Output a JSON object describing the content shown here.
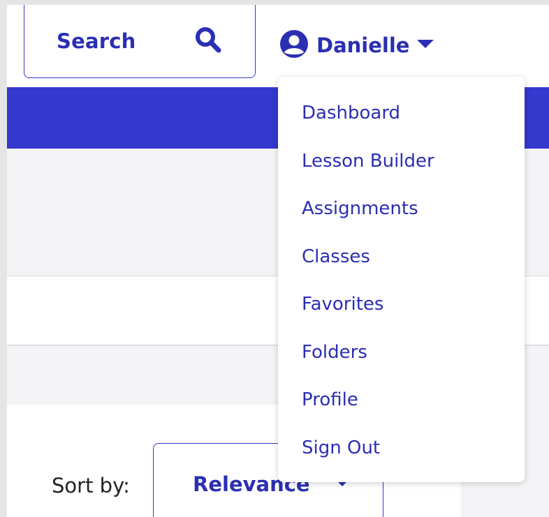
{
  "header": {
    "search_label": "Search",
    "user_name": "Danielle"
  },
  "user_menu": {
    "items": [
      {
        "label": "Dashboard"
      },
      {
        "label": "Lesson Builder"
      },
      {
        "label": "Assignments"
      },
      {
        "label": "Classes"
      },
      {
        "label": "Favorites"
      },
      {
        "label": "Folders"
      },
      {
        "label": "Profile"
      },
      {
        "label": "Sign Out"
      }
    ]
  },
  "sort": {
    "label": "Sort by:",
    "selected": "Relevance"
  },
  "icons": {
    "search": "search-icon",
    "user": "user-circle-icon",
    "caret": "caret-down-icon"
  },
  "colors": {
    "brand": "#3538cd",
    "link": "#2b2fb3",
    "background": "#f4f4f7"
  }
}
